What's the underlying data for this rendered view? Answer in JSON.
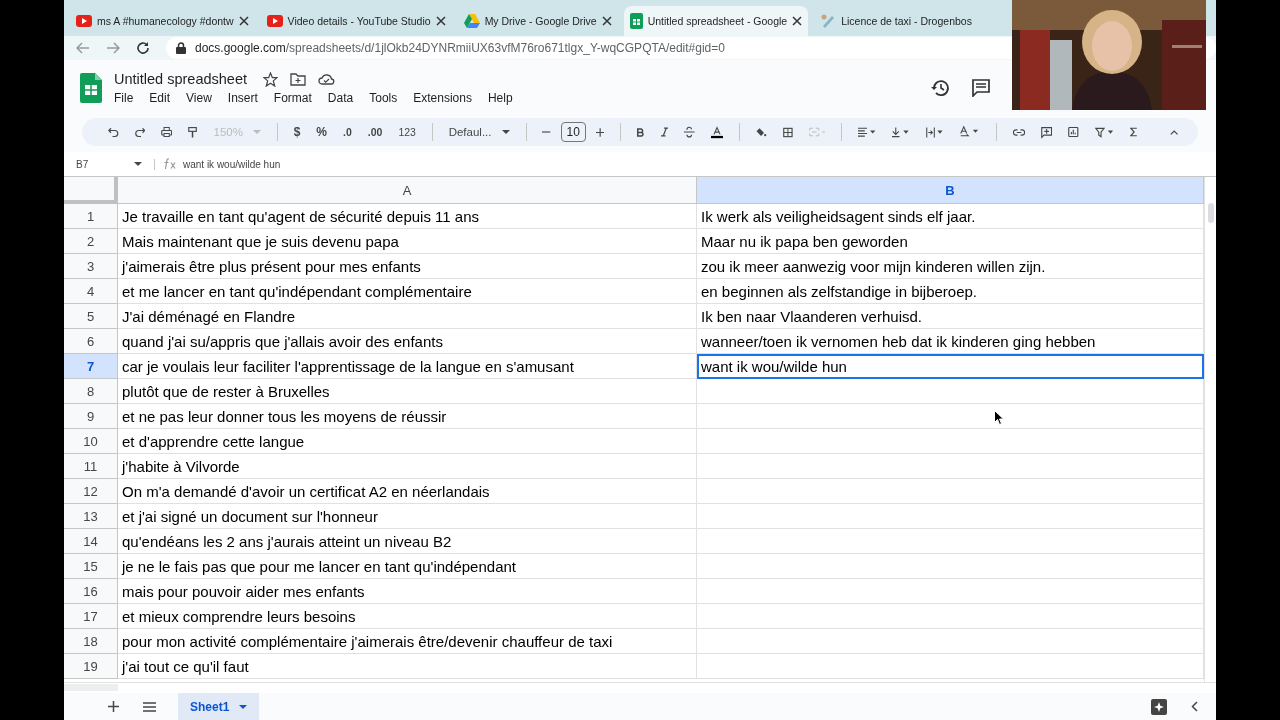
{
  "browser": {
    "tabs": [
      {
        "kind": "youtube",
        "title": "ms A #humanecology #dontw",
        "selected": false
      },
      {
        "kind": "youtube",
        "title": "Video details - YouTube Studio",
        "selected": false
      },
      {
        "kind": "drive",
        "title": "My Drive - Google Drive",
        "selected": false
      },
      {
        "kind": "sheets",
        "title": "Untitled spreadsheet - Google",
        "selected": true
      },
      {
        "kind": "page",
        "title": "Licence de taxi - Drogenbos",
        "selected": false
      }
    ],
    "url_host": "docs.google.com",
    "url_path": "/spreadsheets/d/1jlOkb24DYNRmiiUX63vfM76ro671tlgx_Y-wqCGPQTA/edit#gid=0"
  },
  "document": {
    "title": "Untitled spreadsheet",
    "menu": [
      "File",
      "Edit",
      "View",
      "Insert",
      "Format",
      "Data",
      "Tools",
      "Extensions",
      "Help"
    ]
  },
  "toolbar": {
    "zoom": "150%",
    "currency": "$",
    "percent": "%",
    "decrease_decimals": ".0",
    "increase_decimals": ".00",
    "number_format": "123",
    "font": "Defaul...",
    "font_size": "10"
  },
  "formula_bar": {
    "cell_ref": "B7",
    "value": "want ik wou/wilde hun"
  },
  "columns": [
    {
      "label": "A",
      "selected": false
    },
    {
      "label": "B",
      "selected": true
    }
  ],
  "rows": [
    {
      "number": "1",
      "a": "Je travaille en tant qu'agent de sécurité depuis 11 ans",
      "b": "Ik werk als veiligheidsagent sinds elf jaar.",
      "selected": false
    },
    {
      "number": "2",
      "a": "Mais maintenant que je suis devenu papa",
      "b": "Maar nu ik papa ben geworden",
      "selected": false
    },
    {
      "number": "3",
      "a": "j'aimerais être plus présent pour mes enfants",
      "b": "zou ik meer aanwezig voor mijn kinderen willen zijn.",
      "selected": false
    },
    {
      "number": "4",
      "a": "et me lancer en tant qu'indépendant complémentaire",
      "b": "en beginnen als zelfstandige in bijberoep.",
      "selected": false
    },
    {
      "number": "5",
      "a": "J'ai déménagé en Flandre",
      "b": "Ik ben naar Vlaanderen verhuisd.",
      "selected": false
    },
    {
      "number": "6",
      "a": "quand j'ai su/appris que j'allais avoir des enfants",
      "b": "wanneer/toen ik vernomen heb dat ik kinderen ging hebben",
      "selected": false
    },
    {
      "number": "7",
      "a": "car je voulais leur faciliter l'apprentissage de la langue en s'amusant",
      "b": "want ik wou/wilde hun",
      "selected": true
    },
    {
      "number": "8",
      "a": "plutôt que de rester à Bruxelles",
      "selected": false
    },
    {
      "number": "9",
      "a": "et ne pas leur donner tous les moyens de réussir",
      "selected": false
    },
    {
      "number": "10",
      "a": "et d'apprendre cette langue",
      "selected": false
    },
    {
      "number": "11",
      "a": "j'habite à Vilvorde",
      "selected": false
    },
    {
      "number": "12",
      "a": "On m'a demandé d'avoir un certificat A2 en néerlandais",
      "selected": false
    },
    {
      "number": "13",
      "a": "et j'ai signé un document sur l'honneur",
      "selected": false
    },
    {
      "number": "14",
      "a": "qu'endéans les 2 ans j'aurais atteint un niveau B2",
      "selected": false
    },
    {
      "number": "15",
      "a": "je ne le fais pas que pour me lancer en tant qu'indépendant",
      "selected": false
    },
    {
      "number": "16",
      "a": "mais pour pouvoir aider mes enfants",
      "selected": false
    },
    {
      "number": "17",
      "a": "et mieux comprendre leurs besoins",
      "selected": false
    },
    {
      "number": "18",
      "a": "pour mon activité complémentaire j'aimerais être/devenir chauffeur de taxi",
      "selected": false
    },
    {
      "number": "19",
      "a": "j'ai tout ce qu'il faut",
      "selected": false
    }
  ],
  "sheet_tabs": [
    {
      "label": "Sheet1",
      "selected": true
    }
  ]
}
